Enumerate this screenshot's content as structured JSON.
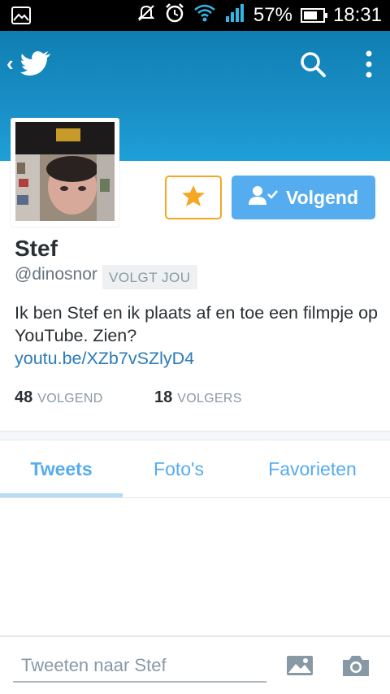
{
  "status_bar": {
    "battery_percent": "57%",
    "time": "18:31",
    "icons": [
      "image-notification-icon",
      "mute-icon",
      "alarm-icon",
      "wifi-icon",
      "signal-icon",
      "battery-icon"
    ]
  },
  "header": {
    "back_icon": "chevron-left-icon",
    "logo_icon": "twitter-bird-icon",
    "actions": [
      "search-icon",
      "overflow-menu-icon"
    ]
  },
  "profile": {
    "name": "Stef",
    "handle": "@dinosnor",
    "follows_you_badge": "VOLGT JOU",
    "bio": "Ik ben Stef en ik plaats af en toe een filmpje op YouTube. Zien?",
    "bio_link": "youtu.be/XZb7vSZlyD4",
    "follow_button_label": "Volgend",
    "stats": {
      "following_count": "48",
      "following_label": "VOLGEND",
      "followers_count": "18",
      "followers_label": "VOLGERS"
    }
  },
  "tabs": [
    {
      "label": "Tweets",
      "active": true
    },
    {
      "label": "Foto's",
      "active": false
    },
    {
      "label": "Favorieten",
      "active": false
    }
  ],
  "compose": {
    "placeholder": "Tweeten naar Stef",
    "icons": [
      "photo-icon",
      "camera-icon"
    ]
  },
  "colors": {
    "brand_blue": "#55acee",
    "banner_blue": "#1a8fc7",
    "star_orange": "#f5a623",
    "link_blue": "#2b7bb9"
  }
}
